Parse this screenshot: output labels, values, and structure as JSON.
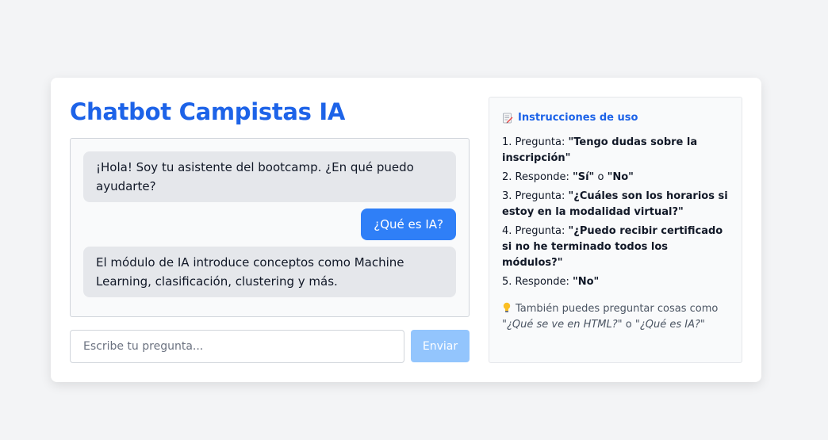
{
  "header": {
    "title": "Chatbot Campistas IA"
  },
  "chat": {
    "messages": [
      {
        "role": "bot",
        "text": "¡Hola! Soy tu asistente del bootcamp. ¿En qué puedo ayudarte?"
      },
      {
        "role": "user",
        "text": "¿Qué es IA?"
      },
      {
        "role": "bot",
        "text": "El módulo de IA introduce conceptos como Machine Learning, clasificación, clustering y más."
      }
    ]
  },
  "composer": {
    "placeholder": "Escribe tu pregunta...",
    "value": "",
    "send_label": "Enviar"
  },
  "instructions": {
    "icon": "memo-icon",
    "title": "Instrucciones de uso",
    "steps": [
      {
        "prefix": "1. Pregunta: ",
        "bold": "\"Tengo dudas sobre la inscripción\""
      },
      {
        "prefix": "2. Responde: ",
        "bold": "\"Sí\"",
        "middle": " o ",
        "bold2": "\"No\""
      },
      {
        "prefix": "3. Pregunta: ",
        "bold": "\"¿Cuáles son los horarios si estoy en la modalidad virtual?\""
      },
      {
        "prefix": "4. Pregunta: ",
        "bold": "\"¿Puedo recibir certificado si no he terminado todos los módulos?\""
      },
      {
        "prefix": "5. Responde: ",
        "bold": "\"No\""
      }
    ],
    "tip": {
      "icon": "lightbulb-icon",
      "text": "También puedes preguntar cosas como ",
      "example1": "\"¿Qué se ve en HTML?\"",
      "connector": " o ",
      "example2": "\"¿Qué es IA?\""
    }
  },
  "colors": {
    "accent": "#1d63e8",
    "user_bubble": "#2f7ff7",
    "bot_bubble": "#e5e7eb",
    "send_disabled": "#93c5fd",
    "page_bg": "#f3f4f6"
  }
}
